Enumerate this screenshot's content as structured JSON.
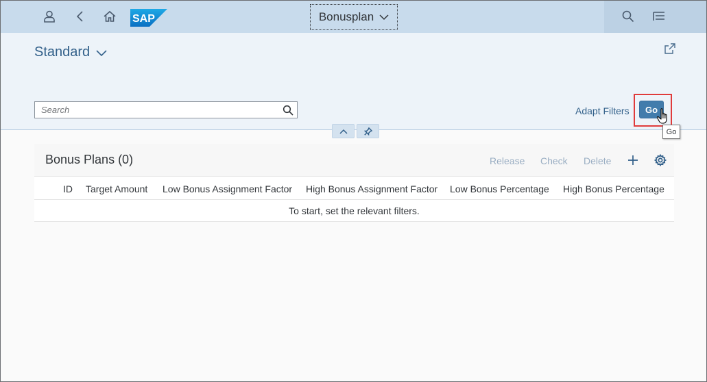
{
  "shell": {
    "app_title": "Bonusplan",
    "logo_text": "SAP",
    "icons": [
      "user-icon",
      "back-icon",
      "home-icon",
      "search-icon",
      "menu-icon"
    ]
  },
  "header": {
    "variant_name": "Standard",
    "search": {
      "placeholder": "Search",
      "value": ""
    },
    "adapt_filters_label": "Adapt Filters",
    "go_label": "Go",
    "tooltip_text": "Go"
  },
  "table": {
    "title": "Bonus Plans (0)",
    "actions": {
      "release": "Release",
      "check": "Check",
      "delete": "Delete"
    },
    "columns": [
      "ID",
      "Target Amount",
      "Low Bonus Assignment Factor",
      "High Bonus Assignment Factor",
      "Low Bonus Percentage",
      "High Bonus Percentage"
    ],
    "empty_text": "To start, set the relevant filters."
  },
  "colors": {
    "shell_bg": "#c8dbec",
    "header_bg": "#edf3f9",
    "go_button": "#427cac",
    "highlight": "#e03b3b",
    "link": "#32608a"
  }
}
